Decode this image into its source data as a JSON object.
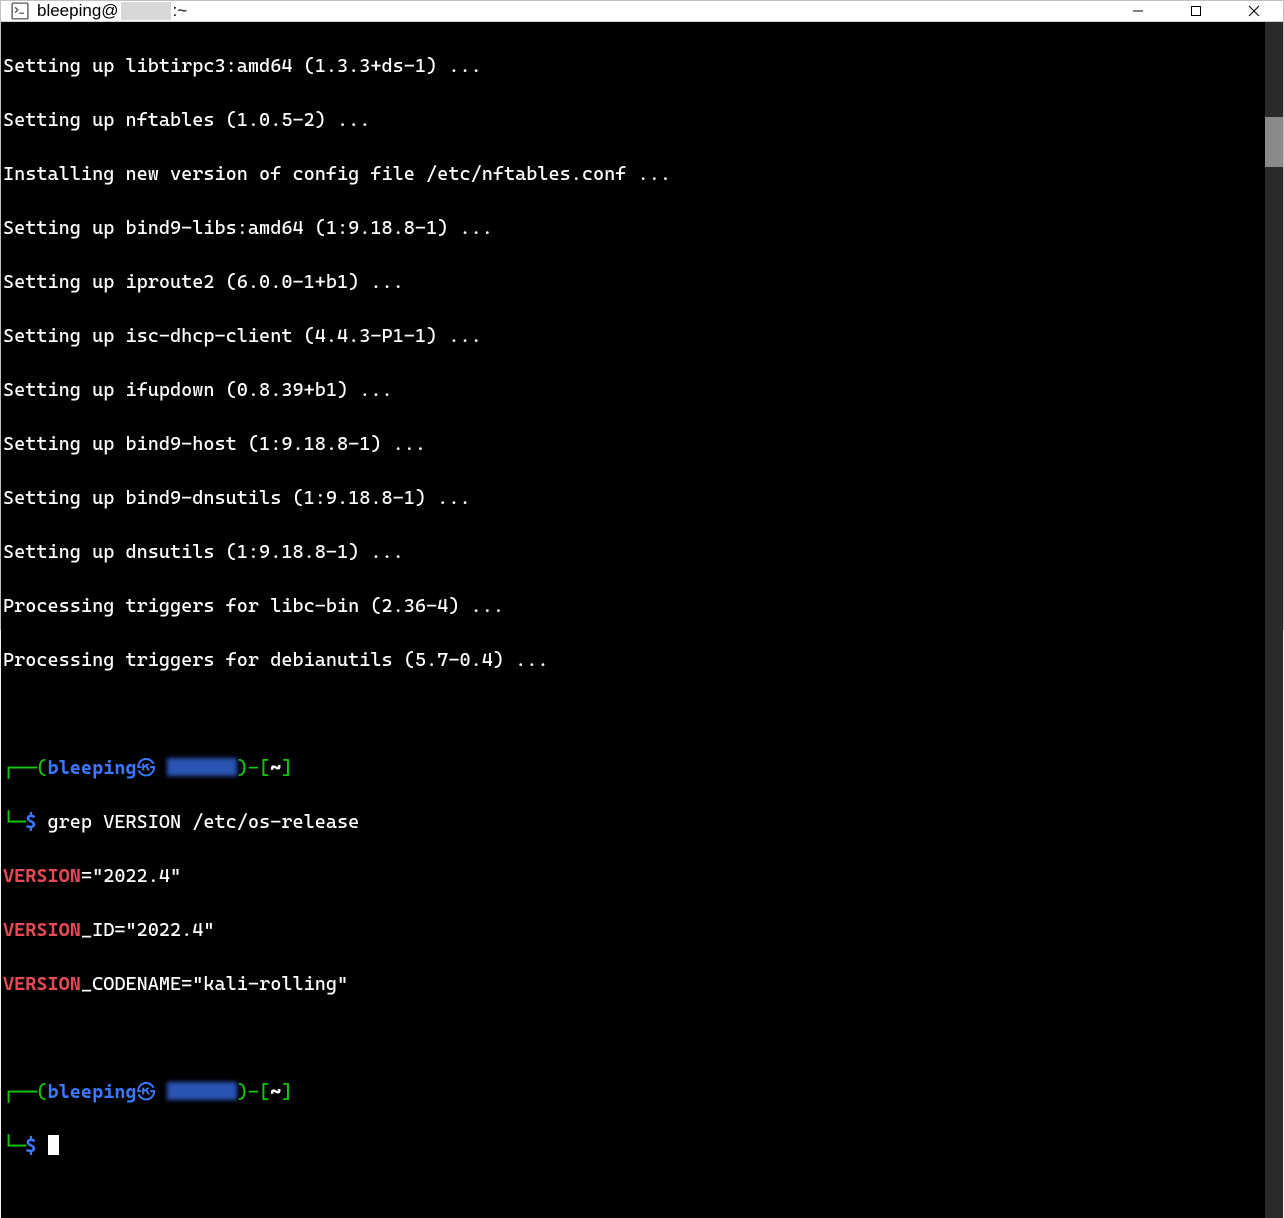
{
  "titlebar": {
    "user": "bleeping",
    "host_redacted": true,
    "path": "~"
  },
  "terminal": {
    "output_lines": [
      "Setting up libtirpc3:amd64 (1.3.3+ds-1) ...",
      "Setting up nftables (1.0.5-2) ...",
      "Installing new version of config file /etc/nftables.conf ...",
      "Setting up bind9-libs:amd64 (1:9.18.8-1) ...",
      "Setting up iproute2 (6.0.0-1+b1) ...",
      "Setting up isc-dhcp-client (4.4.3-P1-1) ...",
      "Setting up ifupdown (0.8.39+b1) ...",
      "Setting up bind9-host (1:9.18.8-1) ...",
      "Setting up bind9-dnsutils (1:9.18.8-1) ...",
      "Setting up dnsutils (1:9.18.8-1) ...",
      "Processing triggers for libc-bin (2.36-4) ...",
      "Processing triggers for debianutils (5.7-0.4) ..."
    ],
    "prompt1": {
      "user": "bleeping",
      "host_redacted": true,
      "path": "~",
      "command": "grep VERSION /etc/os-release"
    },
    "grep_output": [
      {
        "match": "VERSION",
        "rest": "=\"2022.4\""
      },
      {
        "match": "VERSION",
        "rest": "_ID=\"2022.4\""
      },
      {
        "match": "VERSION",
        "rest": "_CODENAME=\"kali-rolling\""
      }
    ],
    "prompt2": {
      "user": "bleeping",
      "host_redacted": true,
      "path": "~",
      "command": ""
    }
  }
}
